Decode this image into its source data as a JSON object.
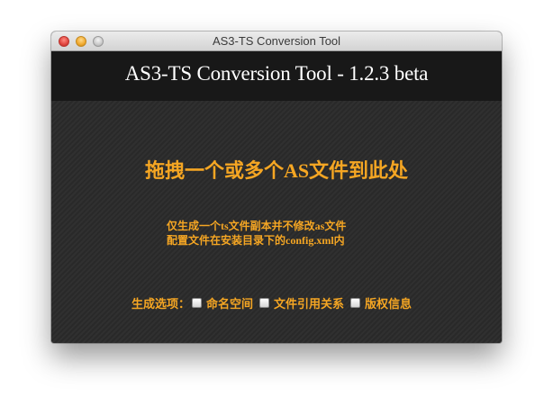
{
  "window": {
    "title": "AS3-TS Conversion Tool"
  },
  "header": {
    "title": "AS3-TS Conversion Tool - 1.2.3 beta"
  },
  "main": {
    "drop_hint": "拖拽一个或多个AS文件到此处",
    "notes": [
      "仅生成一个ts文件副本并不修改as文件",
      "配置文件在安装目录下的config.xml内"
    ],
    "options_label": "生成选项：",
    "options": [
      {
        "label": "命名空间",
        "checked": false
      },
      {
        "label": "文件引用关系",
        "checked": false
      },
      {
        "label": "版权信息",
        "checked": false
      }
    ]
  },
  "colors": {
    "accent": "#f5a623",
    "header_bg": "#181818",
    "content_bg": "#2b2b2b"
  }
}
